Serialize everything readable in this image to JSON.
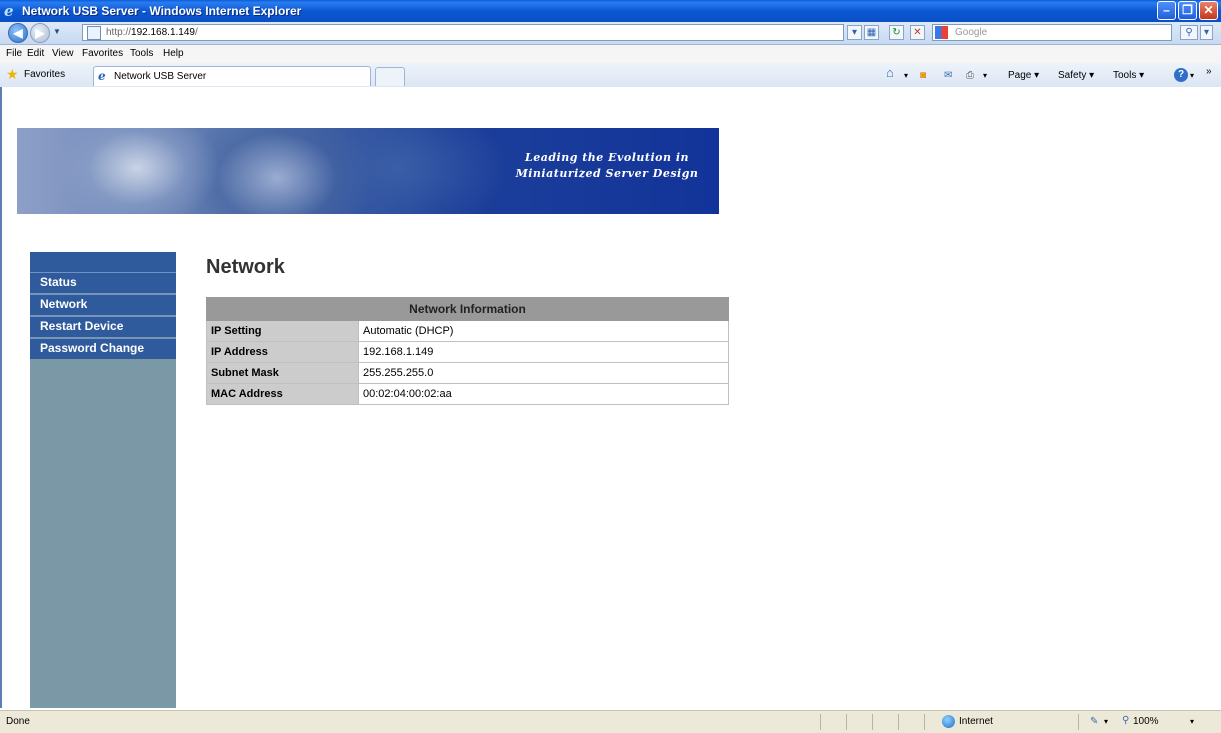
{
  "window": {
    "title": "Network USB Server - Windows Internet Explorer",
    "minimize": "–",
    "maximize": "❐",
    "close": "✕"
  },
  "browser": {
    "address_prefix": "http://",
    "address_host": "192.168.1.149",
    "address_suffix": "/",
    "search_placeholder": "Google",
    "menu": [
      "File",
      "Edit",
      "View",
      "Favorites",
      "Tools",
      "Help"
    ],
    "favorites_label": "Favorites",
    "tab_title": "Network USB Server",
    "tools": {
      "page": "Page ▾",
      "safety": "Safety ▾",
      "tools": "Tools ▾"
    },
    "status_text": "Done",
    "zone": "Internet",
    "zoom": "100%"
  },
  "banner": {
    "tagline_line1": "Leading the Evolution in",
    "tagline_line2": "Miniaturized Server Design"
  },
  "sidebar": {
    "items": [
      {
        "label": "Status"
      },
      {
        "label": "Network"
      },
      {
        "label": "Restart Device"
      },
      {
        "label": "Password Change"
      }
    ]
  },
  "page": {
    "heading": "Network",
    "table_title": "Network Information",
    "rows": [
      {
        "key": "IP Setting",
        "value": "Automatic (DHCP)"
      },
      {
        "key": "IP Address",
        "value": "192.168.1.149"
      },
      {
        "key": "Subnet Mask",
        "value": "255.255.255.0"
      },
      {
        "key": "MAC Address",
        "value": "00:02:04:00:02:aa"
      }
    ]
  },
  "icons": [
    "ie-icon",
    "back-icon",
    "forward-icon",
    "dropdown-icon",
    "page-icon",
    "refresh-icon",
    "stop-icon",
    "search-icon",
    "star-icon",
    "home-icon",
    "feeds-icon",
    "mail-icon",
    "print-icon",
    "help-icon",
    "globe-icon"
  ]
}
